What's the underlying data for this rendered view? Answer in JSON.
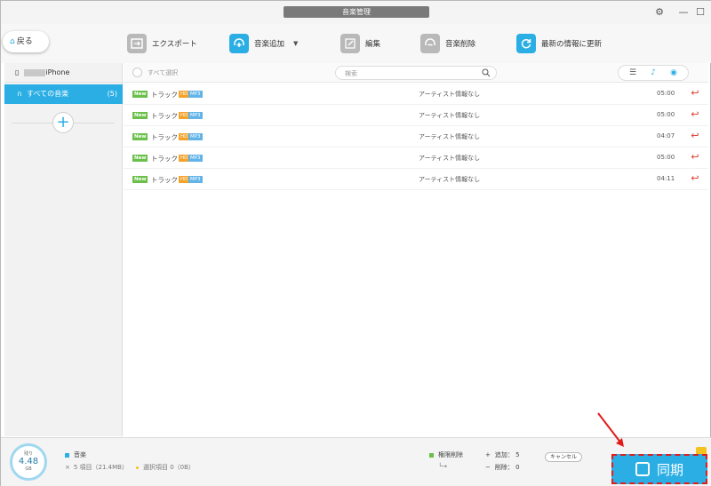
{
  "window": {
    "title": "音楽管理",
    "gear": "⚙",
    "minimize": "—",
    "maximize": "☐"
  },
  "toolbar": {
    "back": "戻る",
    "export": "エクスポート",
    "add_music": "音楽追加",
    "add_music_caret": "▼",
    "edit": "編集",
    "delete": "音楽削除",
    "refresh": "最新の情報に更新"
  },
  "sidebar": {
    "device": "iPhone",
    "all_music": "すべての音楽",
    "all_music_count": "(5)",
    "add": "+"
  },
  "list": {
    "select_all": "すべて選択",
    "search_placeholder": "検索",
    "tracks": [
      {
        "new": "New",
        "title": "トラック 1",
        "hd": "HD",
        "fmt": "MP3",
        "artist": "アーティスト情報なし",
        "duration": "05:00",
        "undo": "↩"
      },
      {
        "new": "New",
        "title": "トラック 2",
        "hd": "HD",
        "fmt": "MP3",
        "artist": "アーティスト情報なし",
        "duration": "05:00",
        "undo": "↩"
      },
      {
        "new": "New",
        "title": "トラック 3",
        "hd": "HD",
        "fmt": "MP3",
        "artist": "アーティスト情報なし",
        "duration": "04:07",
        "undo": "↩"
      },
      {
        "new": "New",
        "title": "トラック 4",
        "hd": "HD",
        "fmt": "MP3",
        "artist": "アーティスト情報なし",
        "duration": "05:00",
        "undo": "↩"
      },
      {
        "new": "New",
        "title": "トラック 5",
        "hd": "HD",
        "fmt": "MP3",
        "artist": "アーティスト情報なし",
        "duration": "04:11",
        "undo": "↩"
      }
    ]
  },
  "bottom": {
    "storage_caption": "残り",
    "storage_value": "4.48",
    "storage_unit": "GB",
    "music_label": "音楽",
    "items_text": "5 項目（21.4MB）",
    "selected_text": "選択項目 0（0B）",
    "rights_label": "権限削除",
    "add_text": "追加： 5",
    "delete_text": "削除： 0",
    "cancel": "キャンセル",
    "sync": "同期"
  },
  "colors": {
    "accent": "#2aaee4",
    "new_badge": "#6ac04a",
    "hd_badge": "#f3a22a",
    "mp3_badge": "#62b4e8",
    "highlight": "#e21b1b"
  }
}
